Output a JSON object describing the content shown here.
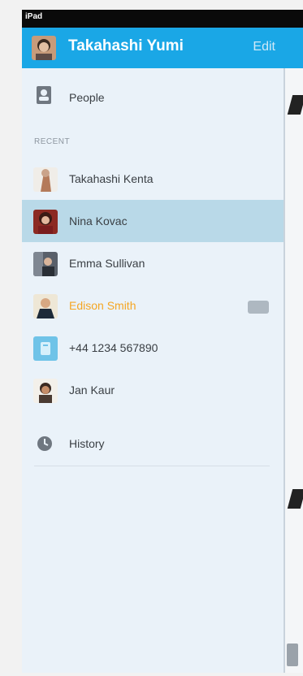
{
  "status": {
    "carrier": "iPad"
  },
  "header": {
    "user_name": "Takahashi Yumi",
    "edit_label": "Edit"
  },
  "nav": {
    "people_label": "People",
    "history_label": "History"
  },
  "recent": {
    "section_label": "RECENT",
    "items": [
      {
        "name": "Takahashi Kenta"
      },
      {
        "name": "Nina Kovac"
      },
      {
        "name": "Emma Sullivan"
      },
      {
        "name": "Edison Smith"
      },
      {
        "name": "+44 1234 567890"
      },
      {
        "name": "Jan Kaur"
      }
    ]
  },
  "colors": {
    "brand": "#1aa7e6",
    "highlight": "#b9d9e8",
    "active_text": "#f5a623"
  }
}
